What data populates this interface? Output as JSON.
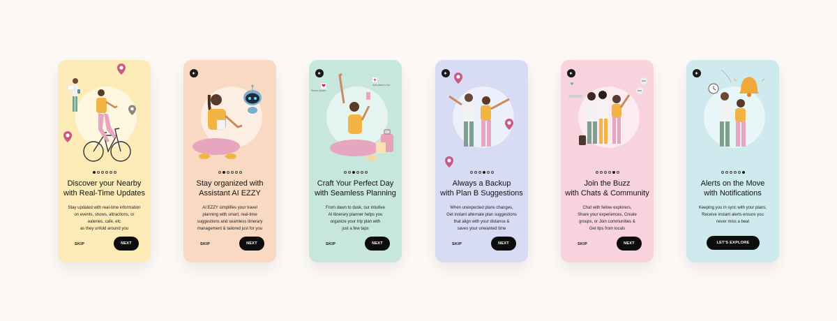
{
  "colors": {
    "card1": "#fcebb6",
    "card2": "#f9d9c2",
    "card3": "#c8e7dc",
    "card4": "#d7dbf3",
    "card5": "#f8d3dd",
    "card6": "#cfeaee",
    "button": "#0d0d0d",
    "page_bg": "#fcf9f6"
  },
  "screens": [
    {
      "title": [
        "Discover your Nearby",
        "with Real-Time Updates"
      ],
      "description": [
        "Stay updated with real-time information",
        "on events, shows, attractions, or",
        "eateries, cafe, etc",
        "as they unfold around you"
      ],
      "active_dot": 1,
      "skip_label": "SKIP",
      "next_label": "NEXT"
    },
    {
      "title": [
        "Stay organized with",
        "Assistant AI EZZY"
      ],
      "description": [
        "AI EZZY simplifies your travel",
        "planning with smart, real-time",
        "suggestions and seamless itinerary",
        "management & tailored just for you"
      ],
      "active_dot": 2,
      "skip_label": "SKIP",
      "next_label": "NEXT"
    },
    {
      "title": [
        "Craft Your Perfect Day",
        "with Seamless Planning"
      ],
      "description": [
        "From dawn to dusk, our intuitive",
        "AI itinerary planner helps you",
        "organize your trip plan with",
        "just a few taps"
      ],
      "active_dot": 3,
      "skip_label": "SKIP",
      "next_label": "NEXT",
      "tag_left": "Saved places",
      "tag_right": "Add place to list"
    },
    {
      "title": [
        "Always a Backup",
        "with Plan B Suggestions"
      ],
      "description": [
        "When unexpected plans changes,",
        "Get instant alternate plan suggestions",
        "that align with your distance &",
        "saves your unwanted time"
      ],
      "active_dot": 4,
      "skip_label": "SKIP",
      "next_label": "NEXT"
    },
    {
      "title": [
        "Join the Buzz",
        "with Chats & Community"
      ],
      "description": [
        "Chat with fellow explorers,",
        "Share your experiences, Create",
        "groups, or Join communities &",
        "Get tips from locals"
      ],
      "active_dot": 5,
      "skip_label": "SKIP",
      "next_label": "NEXT"
    },
    {
      "title": [
        "Alerts on the Move",
        "with Notifications"
      ],
      "description": [
        "Keeping you in sync with your plans,",
        "Receive instant alerts ensure you",
        "never miss a beat"
      ],
      "active_dot": 6,
      "explore_label": "LET'S EXPLORE"
    }
  ],
  "icons": {
    "back": "back-arrow-icon",
    "pin": "location-pin-icon",
    "bell": "bell-icon",
    "clock": "clock-icon",
    "robot": "robot-assistant-icon"
  }
}
